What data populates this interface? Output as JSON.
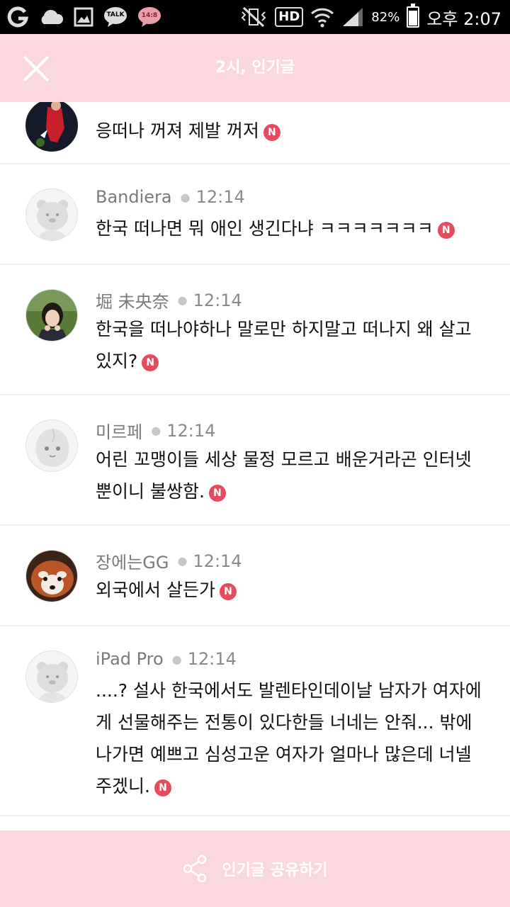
{
  "status_bar": {
    "icons_left": [
      "carrier-g-icon",
      "cloud-icon",
      "gallery-icon",
      "kakaotalk-icon",
      "notification-bubble-icon"
    ],
    "notification_bubble_text": "14:8",
    "talk_icon_text": "TALK",
    "icons_right": [
      "mute-vibrate-icon",
      "hd-icon",
      "wifi-icon",
      "signal-icon",
      "battery-icon"
    ],
    "hd_label": "HD",
    "battery_percent": "82%",
    "time": "오후 2:07"
  },
  "header": {
    "title": "2시, 인기글",
    "background": "#fbd7de"
  },
  "comments": [
    {
      "author": "",
      "time": "",
      "text": "응떠나 꺼져 제발 꺼저",
      "avatar": "soccer-player-photo",
      "badge": "N"
    },
    {
      "author": "Bandiera",
      "time": "12:14",
      "text": "한국 떠나면 뭐 애인 생긴다냐 ㅋㅋㅋㅋㅋㅋㅋ",
      "avatar": "default-bear-avatar",
      "badge": "N"
    },
    {
      "author": "堀 未央奈",
      "time": "12:14",
      "text": "한국을 떠나야하나 말로만 하지말고 떠나지 왜 살고있지?",
      "avatar": "girl-photo",
      "badge": "N"
    },
    {
      "author": "미르페",
      "time": "12:14",
      "text": "어린 꼬맹이들 세상 물정 모르고 배운거라곤 인터넷 뿐이니 불쌍함.",
      "avatar": "default-peach-avatar",
      "badge": "N"
    },
    {
      "author": "장에는GG",
      "time": "12:14",
      "text": "외국에서 살든가",
      "avatar": "red-panda-photo",
      "badge": "N"
    },
    {
      "author": "iPad Pro",
      "time": "12:14",
      "text": "....? 설사 한국에서도 발렌타인데이날 남자가 여자에게 선물해주는 전통이 있다한들 너네는 안줘... 밖에 나가면 예쁘고 심성고운 여자가 얼마나 많은데 너넬 주겠니.",
      "avatar": "default-bear-avatar",
      "badge": "N"
    }
  ],
  "footer": {
    "share_label": "인기글 공유하기",
    "share_icon": "share-icon"
  },
  "colors": {
    "accent_pink": "#fbd7de",
    "badge_red": "#e64a5f"
  }
}
